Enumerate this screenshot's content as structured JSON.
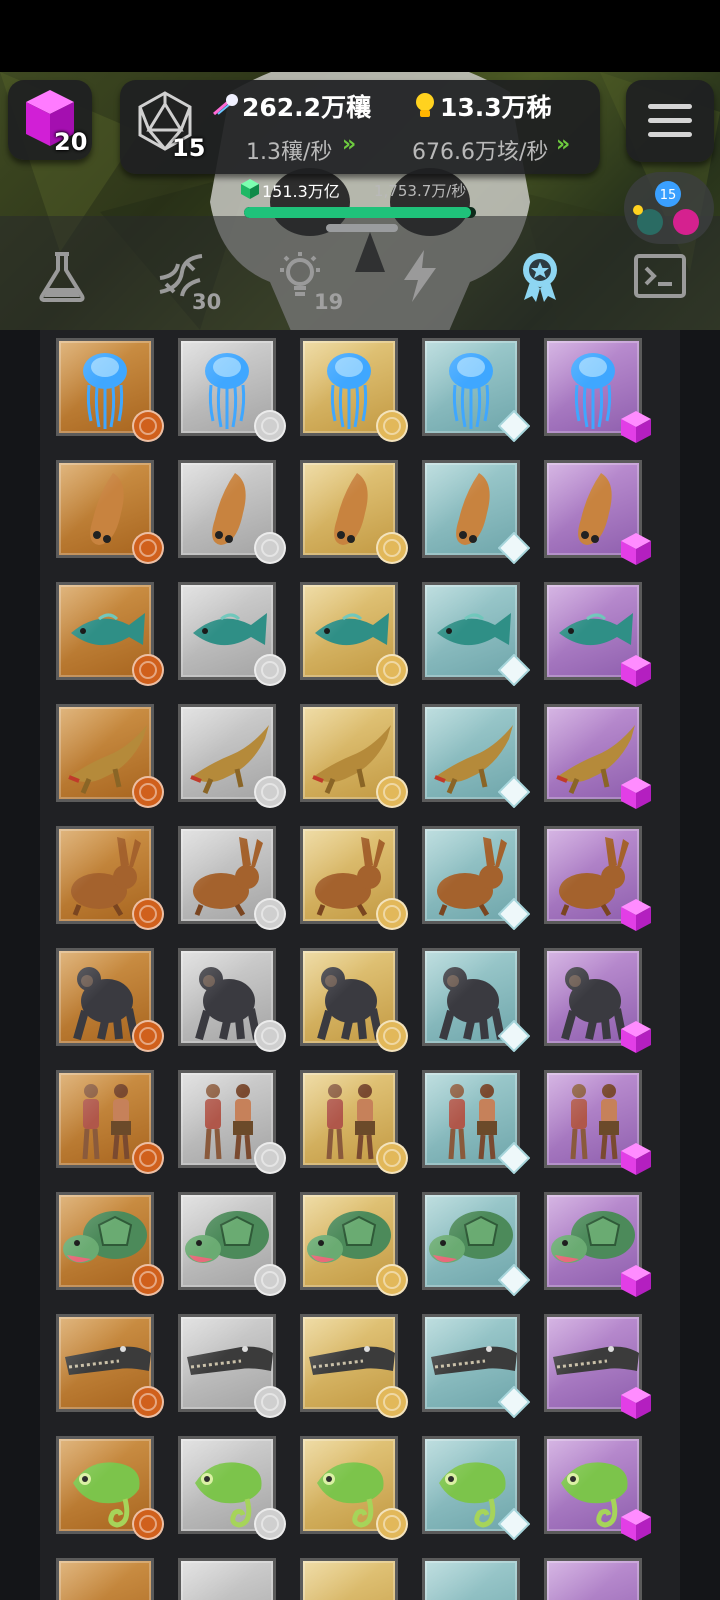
{
  "colors": {
    "bronze": "#b8722a",
    "silver": "#b7b7b7",
    "gold": "#d4ae5a",
    "diamond": "#86bcc0",
    "amethyst": "#a774c2",
    "green_accent": "#6ecb3f",
    "progress": "#1fc27a"
  },
  "hud": {
    "gems": {
      "icon": "magenta-cube-icon",
      "count": "20"
    },
    "dice": {
      "icon": "d20-dice-icon",
      "count": "15"
    },
    "resource_a": {
      "icon": "comet-icon",
      "value": "262.2万穰",
      "rate": "1.3穰/秒"
    },
    "resource_b": {
      "icon": "lightbulb-icon",
      "value": "13.3万秭",
      "rate": "676.6万垓/秒"
    },
    "dna": {
      "icon": "green-cube-icon",
      "value": "151.3万亿",
      "rate": "1,753.7万/秒",
      "progress": 0.98
    },
    "map_badge": "15",
    "menu_icon": "hamburger-menu-icon"
  },
  "tabs": [
    {
      "name": "research",
      "icon": "flask-icon",
      "badge": "",
      "active": false
    },
    {
      "name": "genes",
      "icon": "dna-icon",
      "badge": "30",
      "active": false
    },
    {
      "name": "ideas",
      "icon": "lightbulb-outline-icon",
      "badge": "19",
      "active": false
    },
    {
      "name": "boosts",
      "icon": "lightning-icon",
      "badge": "",
      "active": false
    },
    {
      "name": "achievements",
      "icon": "award-ribbon-icon",
      "badge": "",
      "active": true
    },
    {
      "name": "console",
      "icon": "terminal-icon",
      "badge": "",
      "active": false
    }
  ],
  "grid": {
    "tiers": [
      "bronze",
      "silver",
      "gold",
      "diamond",
      "amethyst"
    ],
    "rows": [
      "jellyfish",
      "worm",
      "fish",
      "amphibian",
      "rabbit",
      "gorilla",
      "humans",
      "turtle",
      "crocodile",
      "chameleon",
      "next"
    ]
  }
}
